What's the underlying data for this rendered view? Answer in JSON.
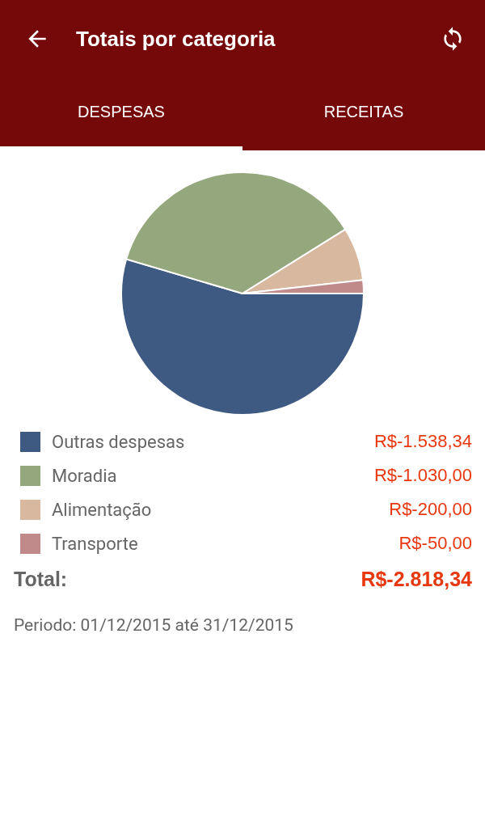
{
  "app_bar": {
    "title": "Totais por categoria"
  },
  "tabs": [
    {
      "label": "DESPESAS",
      "selected": true
    },
    {
      "label": "RECEITAS",
      "selected": false
    }
  ],
  "chart_data": {
    "type": "pie",
    "categories": [
      "Outras despesas",
      "Moradia",
      "Alimentação",
      "Transporte"
    ],
    "values": [
      54.58,
      36.55,
      7.1,
      1.77
    ]
  },
  "legend": [
    {
      "value": "R$-1.538,34",
      "color": "#3e5a82"
    },
    {
      "value": "R$-1.030,00",
      "color": "#95a77c"
    },
    {
      "value": "R$-200,00",
      "color": "#d8b9a0"
    },
    {
      "value": "R$-50,00",
      "color": "#c08a8a"
    }
  ],
  "total": {
    "label": "Total:",
    "value": "R$-2.818,34"
  },
  "period": "Periodo: 01/12/2015 até 31/12/2015"
}
